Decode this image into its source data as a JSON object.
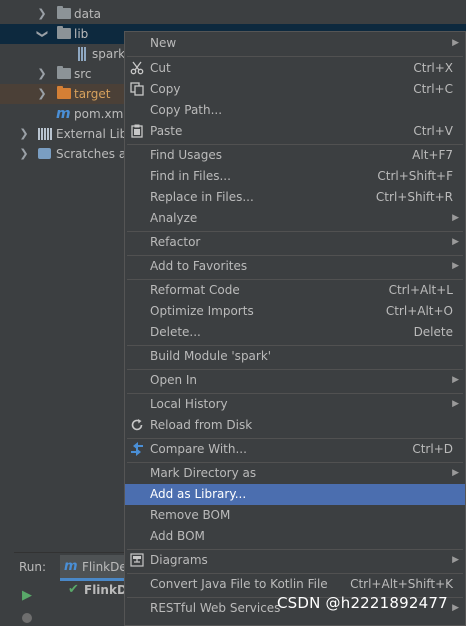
{
  "tree": [
    {
      "label": "data",
      "type": "folder"
    },
    {
      "label": "lib",
      "type": "folder"
    },
    {
      "label": "spark",
      "type": "jar"
    },
    {
      "label": "src",
      "type": "folder"
    },
    {
      "label": "target",
      "type": "folder-excluded"
    },
    {
      "label": "pom.xml",
      "type": "maven"
    },
    {
      "label": "External Libr",
      "type": "libraries"
    },
    {
      "label": "Scratches ar",
      "type": "scratches"
    }
  ],
  "menu": {
    "items": [
      {
        "label": "New",
        "shortcut": "",
        "submenu": true,
        "icon": ""
      },
      {
        "label": "Cut",
        "shortcut": "Ctrl+X",
        "submenu": false,
        "icon": "scissors-icon"
      },
      {
        "label": "Copy",
        "shortcut": "Ctrl+C",
        "submenu": false,
        "icon": "copy-icon"
      },
      {
        "label": "Copy Path...",
        "shortcut": "",
        "submenu": false,
        "icon": ""
      },
      {
        "label": "Paste",
        "shortcut": "Ctrl+V",
        "submenu": false,
        "icon": "clipboard-icon"
      },
      {
        "label": "Find Usages",
        "shortcut": "Alt+F7",
        "submenu": false,
        "icon": ""
      },
      {
        "label": "Find in Files...",
        "shortcut": "Ctrl+Shift+F",
        "submenu": false,
        "icon": ""
      },
      {
        "label": "Replace in Files...",
        "shortcut": "Ctrl+Shift+R",
        "submenu": false,
        "icon": ""
      },
      {
        "label": "Analyze",
        "shortcut": "",
        "submenu": true,
        "icon": ""
      },
      {
        "label": "Refactor",
        "shortcut": "",
        "submenu": true,
        "icon": ""
      },
      {
        "label": "Add to Favorites",
        "shortcut": "",
        "submenu": true,
        "icon": ""
      },
      {
        "label": "Reformat Code",
        "shortcut": "Ctrl+Alt+L",
        "submenu": false,
        "icon": ""
      },
      {
        "label": "Optimize Imports",
        "shortcut": "Ctrl+Alt+O",
        "submenu": false,
        "icon": ""
      },
      {
        "label": "Delete...",
        "shortcut": "Delete",
        "submenu": false,
        "icon": ""
      },
      {
        "label": "Build Module 'spark'",
        "shortcut": "",
        "submenu": false,
        "icon": ""
      },
      {
        "label": "Open In",
        "shortcut": "",
        "submenu": true,
        "icon": ""
      },
      {
        "label": "Local History",
        "shortcut": "",
        "submenu": true,
        "icon": ""
      },
      {
        "label": "Reload from Disk",
        "shortcut": "",
        "submenu": false,
        "icon": "reload-icon"
      },
      {
        "label": "Compare With...",
        "shortcut": "Ctrl+D",
        "submenu": false,
        "icon": "compare-icon"
      },
      {
        "label": "Mark Directory as",
        "shortcut": "",
        "submenu": true,
        "icon": ""
      },
      {
        "label": "Add as Library...",
        "shortcut": "",
        "submenu": false,
        "icon": "",
        "highlighted": true
      },
      {
        "label": "Remove BOM",
        "shortcut": "",
        "submenu": false,
        "icon": ""
      },
      {
        "label": "Add BOM",
        "shortcut": "",
        "submenu": false,
        "icon": ""
      },
      {
        "label": "Diagrams",
        "shortcut": "",
        "submenu": true,
        "icon": "diagram-icon"
      },
      {
        "label": "Convert Java File to Kotlin File",
        "shortcut": "Ctrl+Alt+Shift+K",
        "submenu": false,
        "icon": ""
      },
      {
        "label": "RESTful Web Services",
        "shortcut": "",
        "submenu": true,
        "icon": ""
      }
    ]
  },
  "run_panel": {
    "label": "Run:",
    "tab_label": "FlinkDe",
    "item_label": "FlinkD"
  },
  "watermark": "CSDN @h2221892477",
  "colors": {
    "highlight": "#4b6eaf",
    "background": "#3c3f41",
    "selected_row": "#0d293e",
    "excluded_row": "#4b4037"
  }
}
